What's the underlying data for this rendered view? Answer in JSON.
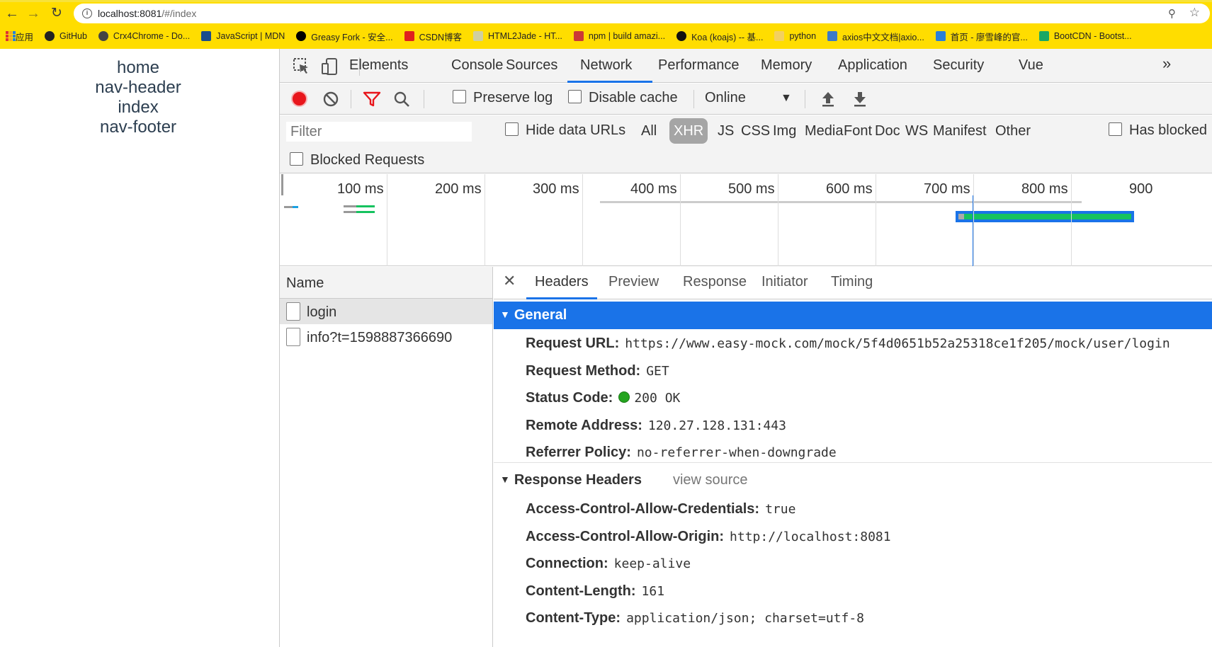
{
  "browser": {
    "url_host": "localhost:8081",
    "url_path": "/#/index",
    "bookmarks": [
      {
        "label": "应用",
        "icon": "apps-grid-icon",
        "color": "#d33"
      },
      {
        "label": "GitHub",
        "icon": "github-icon",
        "color": "#222"
      },
      {
        "label": "Crx4Chrome - Do...",
        "icon": "crx-icon",
        "color": "#444"
      },
      {
        "label": "JavaScript | MDN",
        "icon": "mdn-icon",
        "color": "#1a4d8c"
      },
      {
        "label": "Greasy Fork - 安全...",
        "icon": "greasyfork-icon",
        "color": "#000"
      },
      {
        "label": "CSDN博客",
        "icon": "csdn-icon",
        "color": "#e0201e"
      },
      {
        "label": "HTML2Jade - HT...",
        "icon": "html2jade-icon",
        "color": "#cfcfa0"
      },
      {
        "label": "npm | build amazi...",
        "icon": "npm-icon",
        "color": "#cb3837"
      },
      {
        "label": "Koa (koajs) -- 基...",
        "icon": "koa-icon",
        "color": "#111"
      },
      {
        "label": "python",
        "icon": "folder-icon",
        "color": "#f3d060"
      },
      {
        "label": "axios中文文档|axio...",
        "icon": "axios-icon",
        "color": "#3b79c8"
      },
      {
        "label": "首页 - 廖雪峰的官...",
        "icon": "rocket-icon",
        "color": "#2a7fd8"
      },
      {
        "label": "BootCDN - Bootst...",
        "icon": "bootcdn-icon",
        "color": "#1ba765"
      }
    ]
  },
  "page": {
    "links": [
      "home",
      "nav-header",
      "index",
      "nav-footer"
    ]
  },
  "devtools": {
    "tabs": [
      "Elements",
      "Console",
      "Sources",
      "Network",
      "Performance",
      "Memory",
      "Application",
      "Security",
      "Vue"
    ],
    "active_tab": "Network",
    "more": "»",
    "toolbar": {
      "preserve_log": "Preserve log",
      "disable_cache": "Disable cache",
      "throttling": "Online"
    },
    "filter": {
      "placeholder": "Filter",
      "hide_data_urls": "Hide data URLs",
      "types": [
        "All",
        "XHR",
        "JS",
        "CSS",
        "Img",
        "Media",
        "Font",
        "Doc",
        "WS",
        "Manifest",
        "Other"
      ],
      "active_type": "XHR",
      "has_blocked": "Has blocked",
      "blocked_requests": "Blocked Requests"
    },
    "overview": {
      "ticks": [
        "100 ms",
        "200 ms",
        "300 ms",
        "400 ms",
        "500 ms",
        "600 ms",
        "700 ms",
        "800 ms",
        "900"
      ]
    },
    "requests": {
      "header": "Name",
      "rows": [
        "login",
        "info?t=1598887366690"
      ]
    },
    "detail": {
      "tabs": [
        "Headers",
        "Preview",
        "Response",
        "Initiator",
        "Timing"
      ],
      "active_tab": "Headers",
      "general_title": "General",
      "general": [
        {
          "k": "Request URL:",
          "v": "https://www.easy-mock.com/mock/5f4d0651b52a25318ce1f205/mock/user/login"
        },
        {
          "k": "Request Method:",
          "v": "GET"
        },
        {
          "k": "Status Code:",
          "v": "200 OK"
        },
        {
          "k": "Remote Address:",
          "v": "120.27.128.131:443"
        },
        {
          "k": "Referrer Policy:",
          "v": "no-referrer-when-downgrade"
        }
      ],
      "response_title": "Response Headers",
      "view_source": "view source",
      "response": [
        {
          "k": "Access-Control-Allow-Credentials:",
          "v": "true"
        },
        {
          "k": "Access-Control-Allow-Origin:",
          "v": "http://localhost:8081"
        },
        {
          "k": "Connection:",
          "v": "keep-alive"
        },
        {
          "k": "Content-Length:",
          "v": "161"
        },
        {
          "k": "Content-Type:",
          "v": "application/json; charset=utf-8"
        }
      ]
    }
  },
  "colors": {
    "chrome_bg": "#ffdd00",
    "accent": "#1a73e8",
    "record": "#e8151b"
  }
}
